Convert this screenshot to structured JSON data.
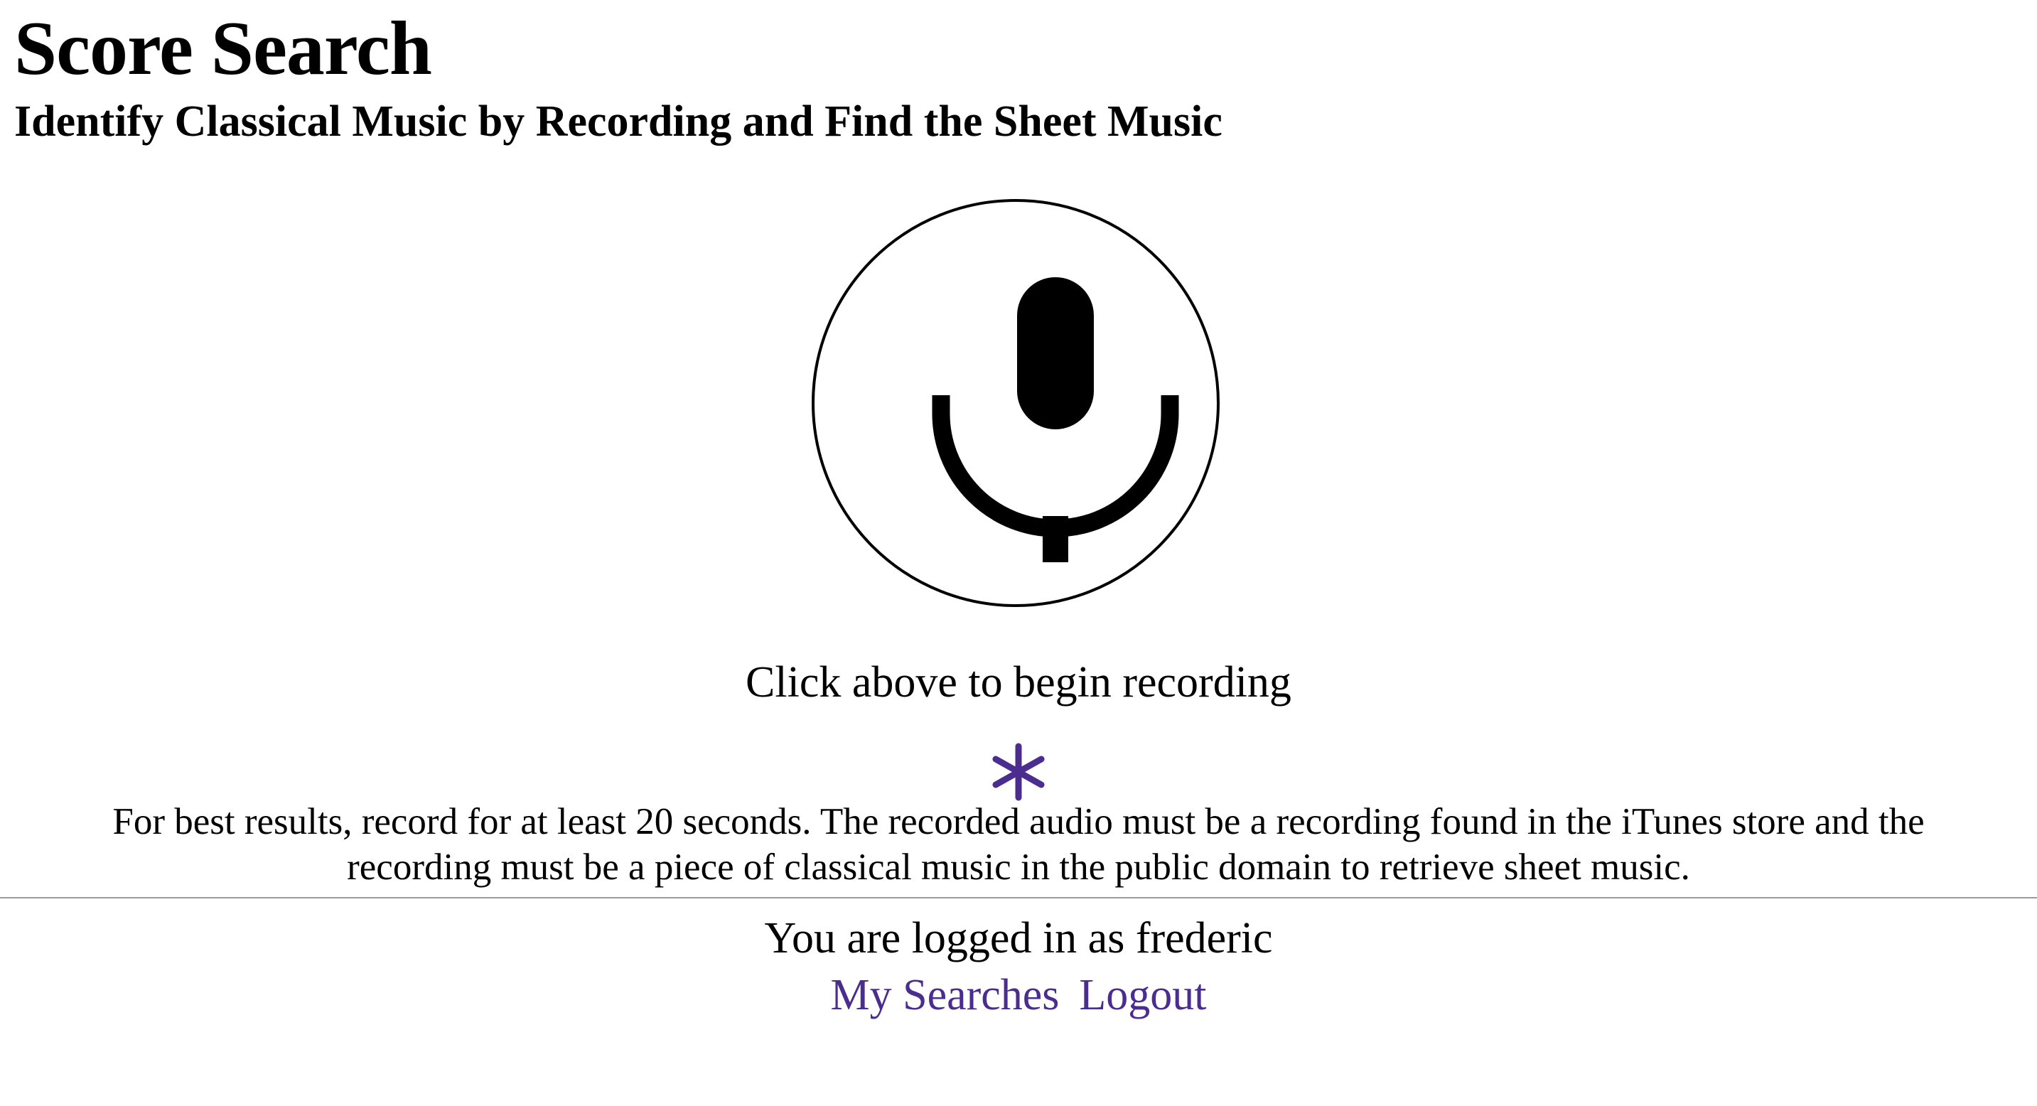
{
  "header": {
    "title": "Score Search",
    "subtitle": "Identify Classical Music by Recording and Find the Sheet Music"
  },
  "recorder": {
    "icon": "microphone-icon",
    "status_text": "Click above to begin recording",
    "indicator_icon": "asterisk-icon",
    "indicator_color": "#4b2c8f"
  },
  "note": {
    "line1": "For best results, record for at least 20 seconds. The recorded audio must be a recording found in the iTunes store and the",
    "line2": "recording must be a piece of classical music in the public domain to retrieve sheet music."
  },
  "footer": {
    "login_text": "You are logged in as frederic",
    "links": [
      {
        "label": "My Searches"
      },
      {
        "label": "Logout"
      }
    ],
    "link_color": "#4b2c8f"
  }
}
